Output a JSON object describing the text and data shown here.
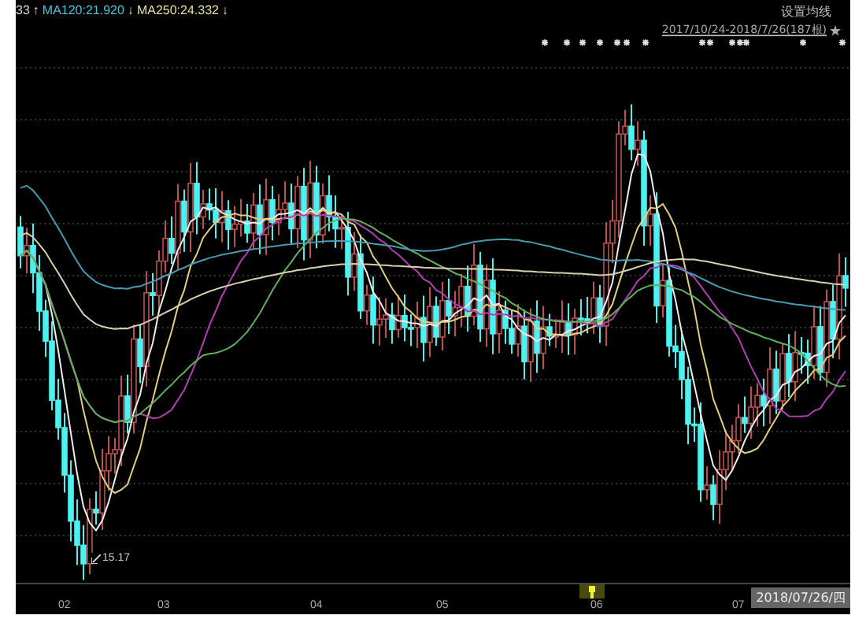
{
  "legend": [
    {
      "label": "33",
      "arrow": "↑",
      "color": "#d8d8d8"
    },
    {
      "label": "MA120:21.920",
      "arrow": "↓",
      "color": "#4fc3dc"
    },
    {
      "label": "MA250:24.332",
      "arrow": "↓",
      "color": "#e8e0a0"
    }
  ],
  "ma_settings_button": {
    "label": "设置均线"
  },
  "date_range": "2017/10/24-2018/7/26(187根)",
  "low_price_label": "15.17",
  "x_axis": {
    "labels": [
      "02",
      "03",
      "04",
      "05",
      "06",
      "07"
    ]
  },
  "current_date": "2018/07/26/四"
}
